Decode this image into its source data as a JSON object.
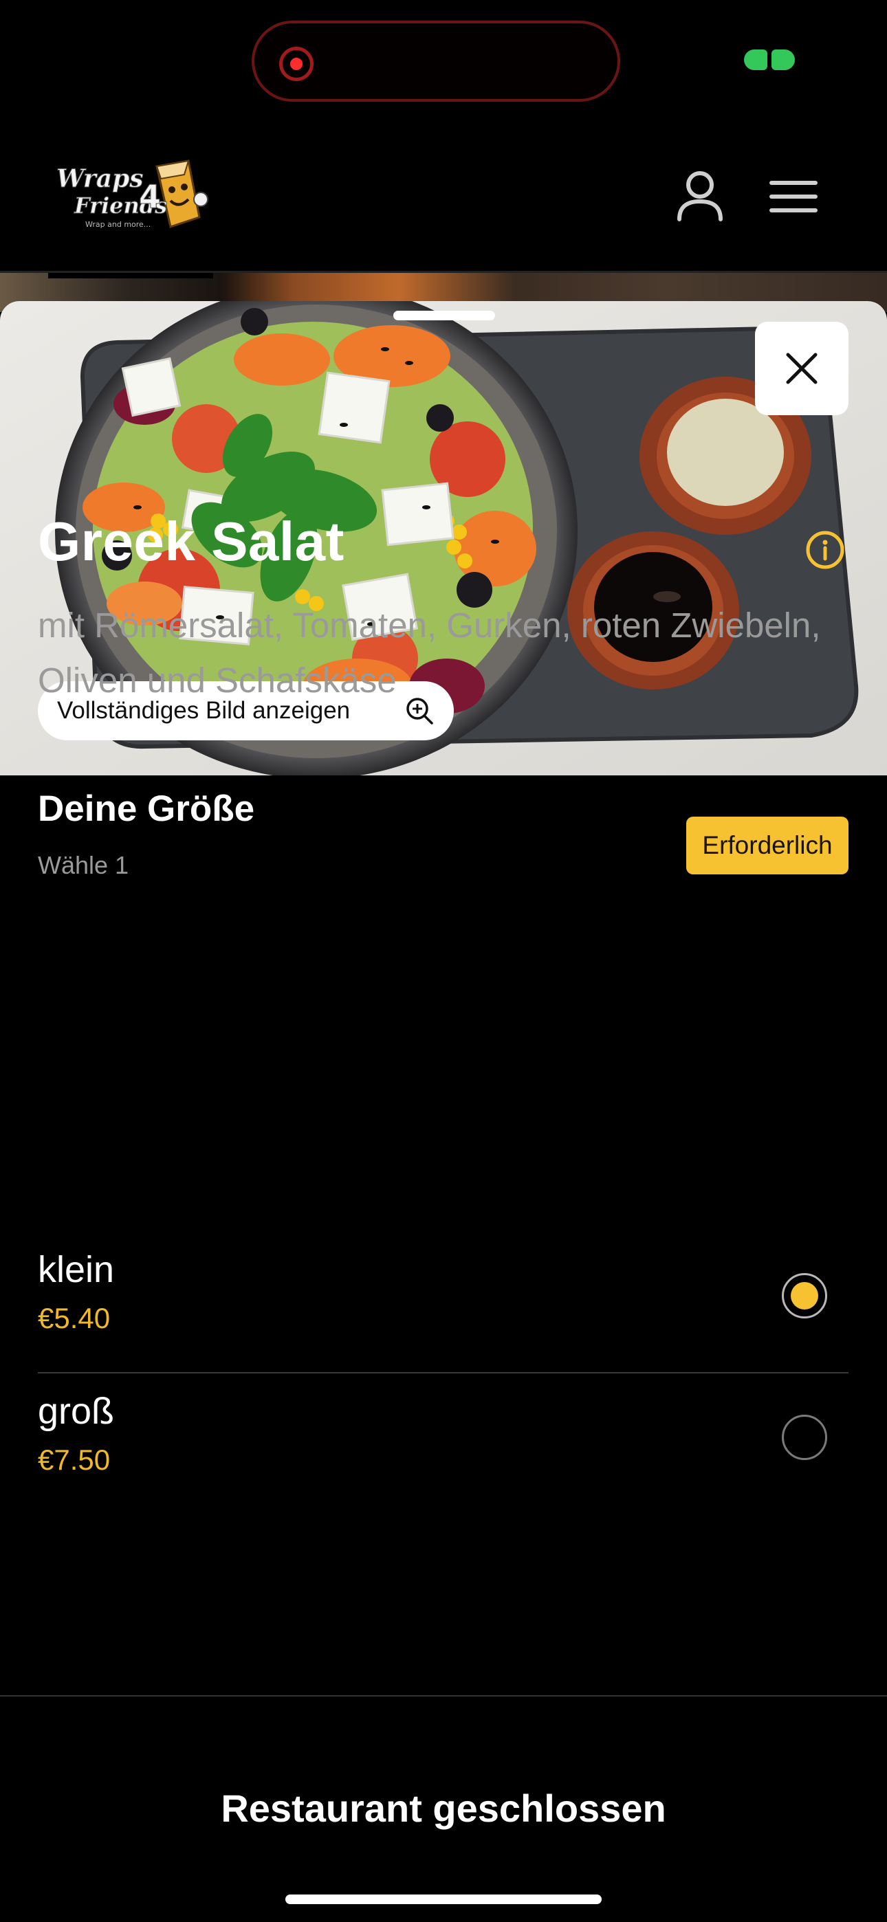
{
  "colors": {
    "accent": "#f7c231",
    "price": "#f2b926",
    "background": "#000000",
    "recording": "#ff2d2d",
    "status_green": "#34c759"
  },
  "header": {
    "logo_alt": "Wraps4Friends",
    "logo_line1": "Wraps",
    "logo_line2": "Friends",
    "logo_number": "4",
    "logo_tagline": "Wrap and more...",
    "account_icon": "user-icon",
    "menu_icon": "hamburger-menu-icon"
  },
  "sheet": {
    "close_icon": "close-icon",
    "view_image_label": "Vollständiges Bild anzeigen",
    "view_image_icon": "zoom-in-icon"
  },
  "item": {
    "title": "Greek Salat",
    "description": "mit Römersalat, Tomaten, Gurken, roten Zwiebeln, Oliven und Schafskäse",
    "info_icon": "info-icon"
  },
  "size_section": {
    "title": "Deine Größe",
    "subtitle": "Wähle 1",
    "badge": "Erforderlich",
    "options": [
      {
        "name": "klein",
        "price": "€5.40",
        "selected": true
      },
      {
        "name": "groß",
        "price": "€7.50",
        "selected": false
      }
    ]
  },
  "footer": {
    "status_text": "Restaurant geschlossen"
  }
}
